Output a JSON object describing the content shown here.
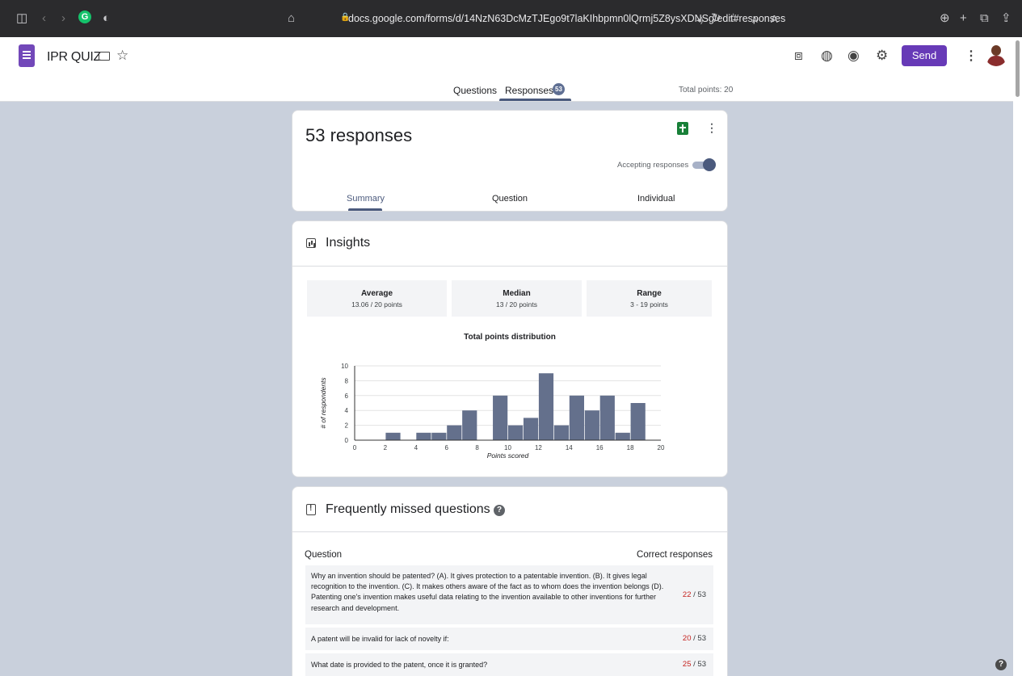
{
  "browser": {
    "url": "docs.google.com/forms/d/14NzN63DcMzTJEgo9t7laKIhbpmn0lQrmj5Z8ysXDNSg/edit#responses"
  },
  "header": {
    "form_title": "IPR QUIZ",
    "send_label": "Send"
  },
  "tabs": {
    "questions": "Questions",
    "responses": "Responses",
    "responses_count": "53",
    "total_points": "Total points: 20"
  },
  "summary_card": {
    "title": "53 responses",
    "accepting_label": "Accepting responses",
    "accepting_on": true,
    "subtabs": [
      "Summary",
      "Question",
      "Individual"
    ]
  },
  "insights": {
    "title": "Insights",
    "stats": [
      {
        "label": "Average",
        "value": "13.06 / 20 points"
      },
      {
        "label": "Median",
        "value": "13 / 20 points"
      },
      {
        "label": "Range",
        "value": "3 - 19 points"
      }
    ],
    "distribution_title": "Total points distribution"
  },
  "chart_data": {
    "type": "bar",
    "title": "Total points distribution",
    "xlabel": "Points scored",
    "ylabel": "# of respondents",
    "xlim": [
      0,
      20
    ],
    "ylim": [
      0,
      10
    ],
    "xticks": [
      0,
      2,
      4,
      6,
      8,
      10,
      12,
      14,
      16,
      18,
      20
    ],
    "yticks": [
      0,
      2,
      4,
      6,
      8,
      10
    ],
    "x": [
      3,
      5,
      6,
      7,
      8,
      10,
      11,
      12,
      13,
      14,
      15,
      16,
      17,
      18,
      19
    ],
    "values": [
      1,
      1,
      1,
      2,
      4,
      6,
      2,
      3,
      9,
      2,
      6,
      4,
      6,
      1,
      5
    ],
    "color": "#64708c",
    "grid": true
  },
  "missed": {
    "title": "Frequently missed questions",
    "col_question": "Question",
    "col_correct": "Correct responses",
    "rows": [
      {
        "q": "Why an invention should be patented? (A). It gives protection to a patentable invention. (B). It gives legal recognition to the invention. (C). It makes others aware of the fact as to whom does the invention belongs (D). Patenting one's invention makes useful data relating to the invention available to other inventions for further research and development.",
        "correct": "22",
        "total": "/ 53"
      },
      {
        "q": "A patent will be invalid for lack of novelty if:",
        "correct": "20",
        "total": "/ 53"
      },
      {
        "q": "What date is provided to the patent, once it is granted?",
        "correct": "25",
        "total": "/ 53"
      }
    ]
  },
  "colors": {
    "accent": "#673ab7",
    "theme": "#4b5a7d",
    "background": "#c9d0dc",
    "incorrect_count": "#c5221f"
  }
}
